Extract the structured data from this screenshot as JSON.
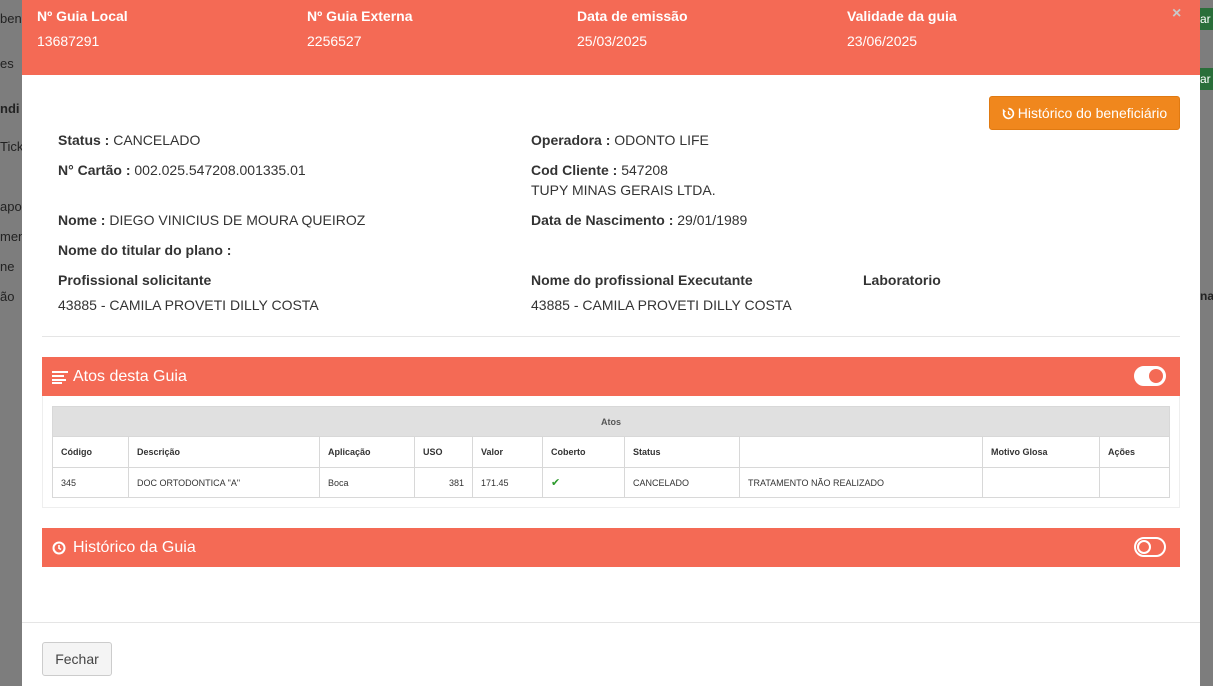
{
  "background": {
    "left_fragments": [
      "ben",
      "es",
      "ndi",
      "Ticke",
      "apo",
      "men",
      "ne",
      "ão"
    ],
    "right_fragments": [
      "ar",
      "ar",
      "na"
    ]
  },
  "header": {
    "guia_local_label": "Nº Guia Local",
    "guia_local_value": "13687291",
    "guia_externa_label": "Nº Guia Externa",
    "guia_externa_value": "2256527",
    "emissao_label": "Data de emissão",
    "emissao_value": "25/03/2025",
    "validade_label": "Validade da guia",
    "validade_value": "23/06/2025",
    "close_label": "×"
  },
  "historico_beneficiario_label": "Histórico do beneficiário",
  "info": {
    "status_label": "Status :",
    "status_value": "CANCELADO",
    "operadora_label": "Operadora :",
    "operadora_value": "ODONTO LIFE",
    "cartao_label": "N° Cartão :",
    "cartao_value": "002.025.547208.001335.01",
    "cod_cliente_label": "Cod Cliente :",
    "cod_cliente_value": "547208",
    "cliente_nome": "TUPY MINAS GERAIS LTDA.",
    "nome_label": "Nome :",
    "nome_value": "DIEGO VINICIUS DE MOURA QUEIROZ",
    "nascimento_label": "Data de Nascimento :",
    "nascimento_value": "29/01/1989",
    "titular_label": "Nome do titular do plano :",
    "solicitante_label": "Profissional solicitante",
    "solicitante_value": "43885 - CAMILA PROVETI DILLY COSTA",
    "executante_label": "Nome do profissional Executante",
    "executante_value": "43885 - CAMILA PROVETI DILLY COSTA",
    "laboratorio_label": "Laboratorio"
  },
  "atos_panel": {
    "title": "Atos desta Guia",
    "toggle_on": true,
    "table_caption": "Atos",
    "columns": [
      "Código",
      "Descrição",
      "Aplicação",
      "USO",
      "Valor",
      "Coberto",
      "Status",
      "",
      "Motivo Glosa",
      "Ações"
    ],
    "rows": [
      [
        "345",
        "DOC ORTODONTICA \"A\"",
        "Boca",
        "381",
        "171.45",
        "✔",
        "CANCELADO",
        "TRATAMENTO NÃO REALIZADO",
        "",
        ""
      ]
    ]
  },
  "historico_panel": {
    "title": "Histórico da Guia",
    "toggle_on": false
  },
  "footer": {
    "close_button_label": "Fechar"
  },
  "colors": {
    "accent": "#f46a55",
    "orange_button": "#f0871d",
    "check_green": "#2c9a2c"
  },
  "icons": {
    "history": "history-icon",
    "list": "list-icon",
    "clock": "clock-icon",
    "close": "close-icon",
    "check": "check-icon"
  }
}
